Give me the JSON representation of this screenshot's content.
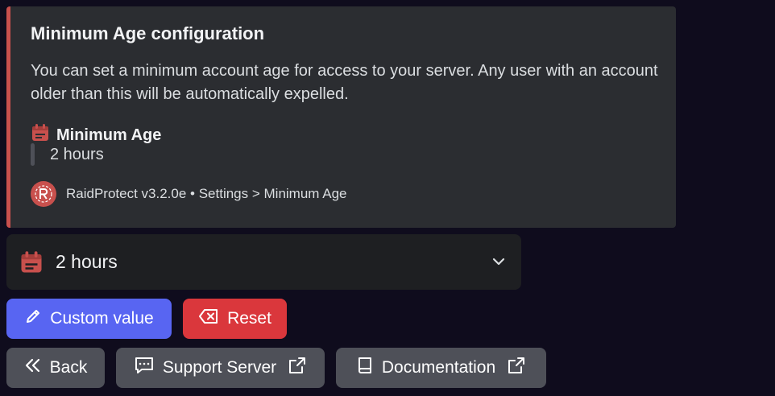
{
  "embed": {
    "title": "Minimum Age configuration",
    "description": "You can set a minimum account age for access to your server. Any user with an account older than this will be automatically expelled.",
    "field_name": "Minimum Age",
    "field_value": "2 hours",
    "footer": "RaidProtect v3.2.0e • Settings > Minimum Age",
    "accent_color": "#c8504d"
  },
  "select": {
    "value": "2 hours",
    "icon": "calendar-icon"
  },
  "buttons": {
    "custom_value": "Custom value",
    "reset": "Reset",
    "back": "Back",
    "support_server": "Support Server",
    "documentation": "Documentation"
  },
  "colors": {
    "primary": "#5865f2",
    "danger": "#da373c",
    "secondary": "#4e5058"
  }
}
